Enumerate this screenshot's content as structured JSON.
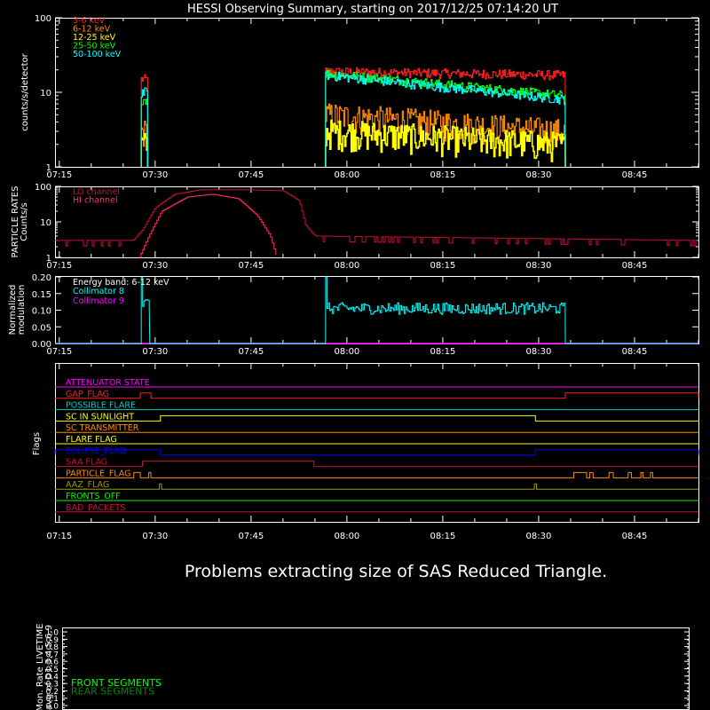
{
  "title": "HESSI Observing Summary, starting on 2017/12/25 07:14:20 UT",
  "time_ticks": [
    "07:15",
    "07:30",
    "07:45",
    "08:00",
    "08:15",
    "08:30",
    "08:45"
  ],
  "message": "Problems extracting size of SAS Reduced Triangle.",
  "colors": {
    "red": "#ff2020",
    "orange": "#ff8c00",
    "yellow": "#ffff00",
    "green": "#00ff00",
    "cyan": "#00ffff",
    "magenta": "#ff00ff",
    "maroon": "#cc1133",
    "blue": "#0000ff",
    "olive": "#999900",
    "white": "#ffffff"
  },
  "chart_data": [
    {
      "type": "line",
      "name": "count rates",
      "ylabel": "counts/s/detector",
      "yscale": "log",
      "ylim": [
        1,
        100
      ],
      "yticks": [
        "100",
        "10",
        "1"
      ],
      "xlim": [
        "07:14:20",
        "08:55:00"
      ],
      "legend_position": "top-left",
      "series": [
        {
          "name": "3-6 keV",
          "color": "#ff2020",
          "segments": [
            {
              "start": "07:27:50",
              "end": "07:28:50",
              "level": 15
            },
            {
              "start": "07:56:40",
              "end": "08:34:10",
              "level_start": 19,
              "level_end": 17
            }
          ]
        },
        {
          "name": "6-12 keV",
          "color": "#ff8c00",
          "segments": [
            {
              "start": "07:27:50",
              "end": "07:28:50",
              "level": 3
            },
            {
              "start": "07:56:40",
              "end": "08:34:10",
              "level_start": 5,
              "level_end": 3
            }
          ]
        },
        {
          "name": "12-25 keV",
          "color": "#ffff00",
          "segments": [
            {
              "start": "07:27:50",
              "end": "07:28:50",
              "level": 2
            },
            {
              "start": "07:56:40",
              "end": "08:34:10",
              "level_start": 3,
              "level_end": 2
            }
          ]
        },
        {
          "name": "25-50 keV",
          "color": "#00ff00",
          "segments": [
            {
              "start": "07:27:50",
              "end": "07:28:50",
              "level": 8
            },
            {
              "start": "07:56:40",
              "end": "08:34:10",
              "level_start": 18,
              "level_end": 9
            }
          ]
        },
        {
          "name": "50-100 keV",
          "color": "#00ffff",
          "segments": [
            {
              "start": "07:27:50",
              "end": "07:28:50",
              "level": 10
            },
            {
              "start": "07:56:40",
              "end": "08:34:10",
              "level_start": 17,
              "level_end": 8
            }
          ]
        }
      ]
    },
    {
      "type": "line",
      "name": "particle rates",
      "ylabel": "PARTICLE RATES\nCounts/s",
      "yscale": "log",
      "ylim": [
        1,
        100
      ],
      "yticks": [
        "100",
        "10",
        "1"
      ],
      "legend_position": "top-left",
      "series": [
        {
          "name": "LO channel",
          "color": "#cc1133",
          "points": [
            [
              "07:14:20",
              3
            ],
            [
              "07:26:30",
              3
            ],
            [
              "07:28:00",
              6
            ],
            [
              "07:30:00",
              25
            ],
            [
              "07:33:00",
              60
            ],
            [
              "07:37:00",
              80
            ],
            [
              "07:45:00",
              80
            ],
            [
              "07:50:00",
              75
            ],
            [
              "07:52:30",
              40
            ],
            [
              "07:53:30",
              8
            ],
            [
              "07:55:00",
              4
            ],
            [
              "08:55:00",
              3
            ]
          ]
        },
        {
          "name": "HI channel",
          "color": "#ff3366",
          "points": [
            [
              "07:27:30",
              1
            ],
            [
              "07:29:00",
              4
            ],
            [
              "07:31:00",
              20
            ],
            [
              "07:35:00",
              50
            ],
            [
              "07:39:00",
              60
            ],
            [
              "07:43:00",
              45
            ],
            [
              "07:46:00",
              15
            ],
            [
              "07:48:00",
              4
            ],
            [
              "07:49:00",
              1
            ]
          ]
        }
      ]
    },
    {
      "type": "line",
      "name": "normalized modulation",
      "ylabel": "Normalized\nmodulation",
      "ylim": [
        0,
        0.2
      ],
      "yticks": [
        "0.20",
        "0.15",
        "0.10",
        "0.05",
        "0.00"
      ],
      "legend_title": "Energy band: 6-12 keV",
      "series": [
        {
          "name": "Collimator 8",
          "color": "#00ffff",
          "segments": [
            {
              "start": "07:27:50",
              "end": "07:29:10",
              "level": 0.12
            },
            {
              "start": "07:56:40",
              "end": "08:34:10",
              "level": 0.105
            }
          ]
        },
        {
          "name": "Collimator 9",
          "color": "#ff00ff",
          "level": 0.0
        }
      ]
    },
    {
      "type": "line",
      "name": "flags",
      "ylabel": "Flags",
      "series": [
        {
          "name": "ATTENUATOR STATE",
          "color": "#ff00ff"
        },
        {
          "name": "GAP_FLAG",
          "color": "#ff2020",
          "intervals": [
            [
              "07:27:40",
              "07:29:20"
            ],
            [
              "08:34:10",
              "08:55:00"
            ]
          ]
        },
        {
          "name": "POSSIBLE FLARE",
          "color": "#00cccc"
        },
        {
          "name": "SC IN SUNLIGHT",
          "color": "#ffff00",
          "intervals": [
            [
              "07:30:50",
              "08:29:30"
            ]
          ]
        },
        {
          "name": "SC TRANSMITTER",
          "color": "#ff8c00"
        },
        {
          "name": "FLARE FLAG",
          "color": "#ffff00"
        },
        {
          "name": "ECLIPSE_FLAG",
          "color": "#0000ff",
          "intervals": [
            [
              "07:14:20",
              "07:30:50"
            ],
            [
              "08:29:30",
              "08:55:00"
            ]
          ]
        },
        {
          "name": "SAA FLAG",
          "color": "#cc1133",
          "intervals": [
            [
              "07:28:00",
              "07:54:50"
            ]
          ]
        },
        {
          "name": "PARTICLE_FLAG",
          "color": "#ff8c00",
          "intervals": [
            [
              "07:26:40",
              "07:27:40"
            ],
            [
              "07:29:00",
              "07:29:20"
            ],
            [
              "08:35:30",
              "08:37:30"
            ],
            [
              "08:38:00",
              "08:38:30"
            ],
            [
              "08:41:00",
              "08:41:40"
            ],
            [
              "08:44:00",
              "08:44:30"
            ],
            [
              "08:46:00",
              "08:46:20"
            ],
            [
              "08:47:30",
              "08:47:50"
            ]
          ]
        },
        {
          "name": "AAZ_FLAG",
          "color": "#999900",
          "intervals": [
            [
              "07:30:40",
              "07:31:00"
            ],
            [
              "08:29:20",
              "08:29:40"
            ]
          ]
        },
        {
          "name": "FRONTS_OFF",
          "color": "#00ff00"
        },
        {
          "name": "BAD_PACKETS",
          "color": "#cc1133"
        }
      ]
    },
    {
      "type": "line",
      "name": "monitor livetime",
      "ylabel": "Mon. Rate LIVETIME\navg of D1,3,4,5,6,9",
      "ylim": [
        0,
        1
      ],
      "yticks": [
        "1.0",
        "0.9",
        "0.8",
        "0.7",
        "0.6",
        "0.5",
        "0.4",
        "0.3",
        "0.2",
        "0.1",
        "0.0"
      ],
      "series": [
        {
          "name": "FRONT SEGMENTS",
          "color": "#00ff00"
        },
        {
          "name": "REAR SEGMENTS",
          "color": "#008800"
        }
      ]
    }
  ]
}
